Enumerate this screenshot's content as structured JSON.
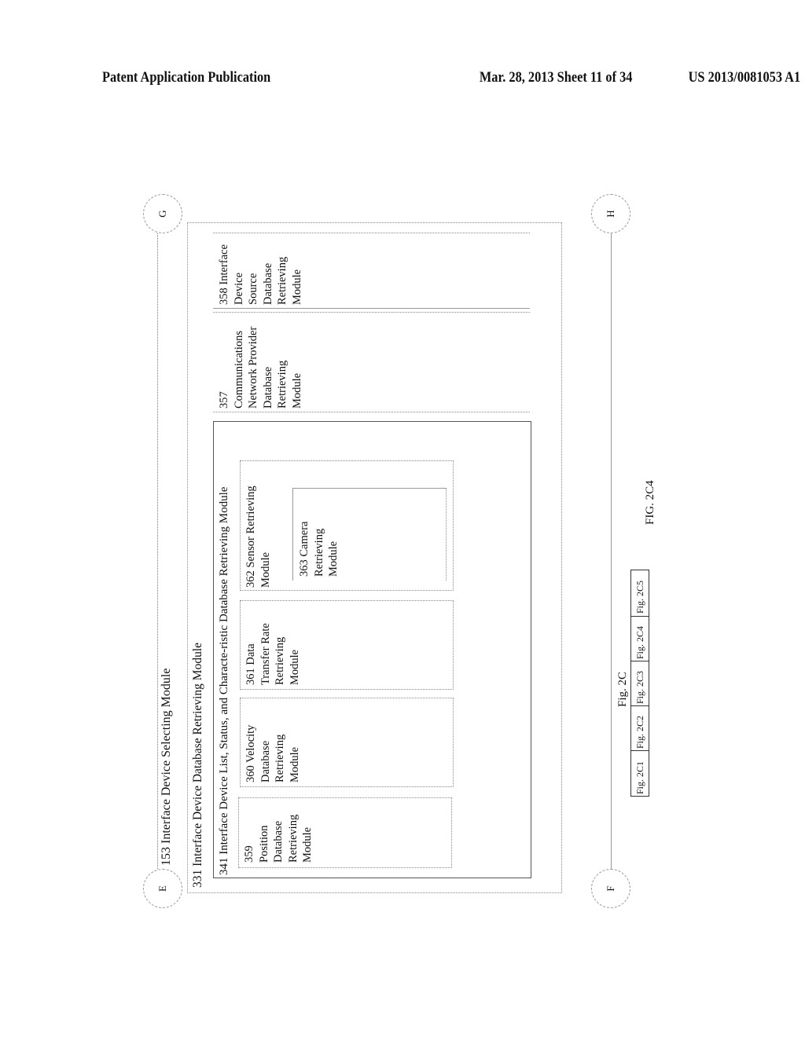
{
  "header": {
    "publication": "Patent Application Publication",
    "date_sheet": "Mar. 28, 2013  Sheet 11 of 34",
    "number": "US 2013/0081053 A1"
  },
  "connectors": {
    "top_left": "E",
    "top_right": "G",
    "bottom_left": "F",
    "bottom_right": "H"
  },
  "modules": {
    "m153": "153 Interface Device Selecting Module",
    "m331": "331 Interface Device Database Retrieving Module",
    "m341": "341 Interface Device List, Status, and Characte-ristic Database Retrieving Module",
    "m359": [
      "359",
      "Position",
      "Database",
      "Retrieving",
      "Module"
    ],
    "m360": [
      "360 Velocity",
      "Database",
      "Retrieving",
      "Module"
    ],
    "m361": [
      "361 Data",
      "Transfer Rate",
      "Retrieving",
      "Module"
    ],
    "m362": [
      "362 Sensor Retrieving",
      "Module"
    ],
    "m363": [
      "363 Camera",
      "Retrieving",
      "Module"
    ],
    "m357": [
      "357",
      "Communications",
      "Network Provider",
      "Database",
      "Retrieving",
      "Module"
    ],
    "m358": [
      "358 Interface",
      "Device",
      "Source",
      "Database",
      "Retrieving",
      "Module"
    ]
  },
  "figure_index": {
    "title": "Fig. 2C",
    "cells": [
      "Fig. 2C1",
      "Fig. 2C2",
      "Fig. 2C3",
      "Fig. 2C4",
      "Fig. 2C5"
    ]
  },
  "figure_label": "FIG. 2C4"
}
